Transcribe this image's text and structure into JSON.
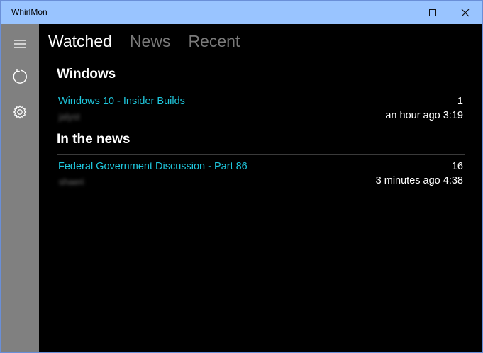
{
  "window": {
    "title": "WhirlMon"
  },
  "tabs": [
    {
      "label": "Watched",
      "active": true
    },
    {
      "label": "News",
      "active": false
    },
    {
      "label": "Recent",
      "active": false
    }
  ],
  "sidebar": {
    "icons": [
      "hamburger-menu-icon",
      "refresh-icon",
      "settings-gear-icon"
    ]
  },
  "sections": [
    {
      "title": "Windows",
      "threads": [
        {
          "title": "Windows 10 - Insider Builds",
          "author": "jalyst",
          "count": "1",
          "time": "an hour ago 3:19"
        }
      ]
    },
    {
      "title": "In the news",
      "threads": [
        {
          "title": "Federal Government Discussion - Part 86",
          "author": "shaeri",
          "count": "16",
          "time": "3 minutes ago 4:38"
        }
      ]
    }
  ],
  "colors": {
    "titlebar": "#99c4ff",
    "sidebar": "#808080",
    "link": "#1fc8de",
    "background": "#000000"
  }
}
